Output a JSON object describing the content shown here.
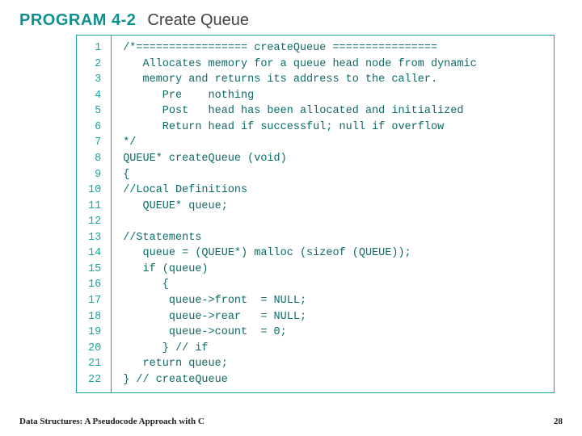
{
  "heading": {
    "label": "PROGRAM 4-2",
    "title": "Create Queue"
  },
  "code": {
    "lines": [
      {
        "num": "1",
        "text": "/*================= createQueue ================"
      },
      {
        "num": "2",
        "text": "   Allocates memory for a queue head node from dynamic"
      },
      {
        "num": "3",
        "text": "   memory and returns its address to the caller."
      },
      {
        "num": "4",
        "text": "      Pre    nothing"
      },
      {
        "num": "5",
        "text": "      Post   head has been allocated and initialized"
      },
      {
        "num": "6",
        "text": "      Return head if successful; null if overflow"
      },
      {
        "num": "7",
        "text": "*/"
      },
      {
        "num": "8",
        "text": "QUEUE* createQueue (void)"
      },
      {
        "num": "9",
        "text": "{"
      },
      {
        "num": "10",
        "text": "//Local Definitions"
      },
      {
        "num": "11",
        "text": "   QUEUE* queue;"
      },
      {
        "num": "12",
        "text": ""
      },
      {
        "num": "13",
        "text": "//Statements"
      },
      {
        "num": "14",
        "text": "   queue = (QUEUE*) malloc (sizeof (QUEUE));"
      },
      {
        "num": "15",
        "text": "   if (queue)"
      },
      {
        "num": "16",
        "text": "      {"
      },
      {
        "num": "17",
        "text": "       queue->front  = NULL;"
      },
      {
        "num": "18",
        "text": "       queue->rear   = NULL;"
      },
      {
        "num": "19",
        "text": "       queue->count  = 0;"
      },
      {
        "num": "20",
        "text": "      } // if"
      },
      {
        "num": "21",
        "text": "   return queue;"
      },
      {
        "num": "22",
        "text": "} // createQueue"
      }
    ]
  },
  "footer": {
    "left": "Data Structures: A Pseudocode Approach with C",
    "right": "28"
  }
}
